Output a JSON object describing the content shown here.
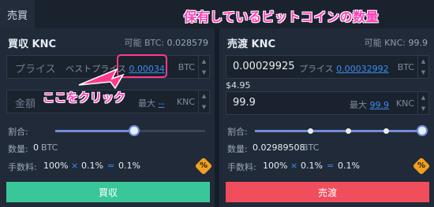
{
  "tab": {
    "label": "売買"
  },
  "annotations": {
    "title": "保有しているビットコインの数量",
    "click": "ここをクリック"
  },
  "buy": {
    "title": "買収 KNC",
    "avail_label": "可能 BTC:",
    "avail_value": "0.028579",
    "price_placeholder": "プライス",
    "best_label": "ベストプライス",
    "best_value": "0.00034",
    "price_unit": "BTC",
    "amount_placeholder": "金額",
    "max_label": "最大",
    "max_value": "--",
    "amount_unit": "KNC",
    "ratio_label": "割合:",
    "ratio_value": 1.0,
    "qty_label": "数量:",
    "qty_value": "0",
    "qty_unit": "BTC",
    "fee_label": "手数料:",
    "fee_a": "100%",
    "fee_op1": "×",
    "fee_b": "0.1%",
    "fee_op2": "=",
    "fee_c": "0.1%",
    "fee_badge": "%",
    "button": "買収"
  },
  "sell": {
    "title": "売渡 KNC",
    "avail_label": "可能 KNC:",
    "avail_value": "99.9",
    "price_value": "0.00029925",
    "price_label": "プライス",
    "price_best": "0.00032992",
    "price_unit": "BTC",
    "usd": "$4.95",
    "amount_value": "99.9",
    "max_label": "最大",
    "max_value": "99.9",
    "amount_unit": "KNC",
    "ratio_label": "割合:",
    "ratio_value": 1.0,
    "qty_label": "数量:",
    "qty_value": "0.02989508",
    "qty_unit": "BTC",
    "fee_label": "手数料:",
    "fee_a": "100%",
    "fee_op1": "×",
    "fee_b": "0.1%",
    "fee_op2": "=",
    "fee_c": "0.1%",
    "fee_badge": "%",
    "button": "売渡"
  },
  "colors": {
    "buy": "#39c79a",
    "sell": "#f04d5d",
    "link": "#3a8df0",
    "annotation": "#ff40b8"
  }
}
